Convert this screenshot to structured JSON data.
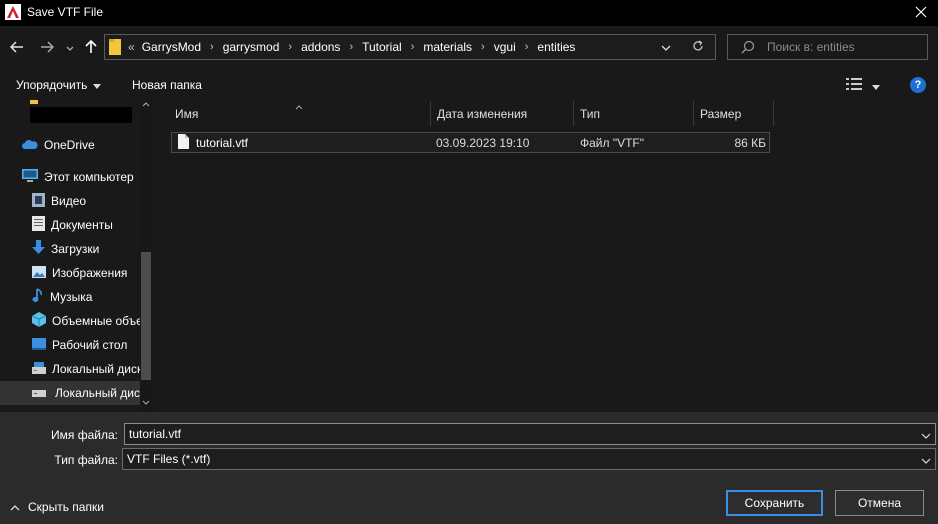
{
  "window": {
    "title": "Save VTF File"
  },
  "nav": {
    "breadcrumb_prefix": "«",
    "breadcrumbs": [
      "GarrysMod",
      "garrysmod",
      "addons",
      "Tutorial",
      "materials",
      "vgui",
      "entities"
    ],
    "search_placeholder": "Поиск в: entities"
  },
  "toolbar": {
    "organize_label": "Упорядочить",
    "new_folder_label": "Новая папка"
  },
  "sidebar": {
    "items": [
      {
        "label": "OneDrive",
        "icon": "cloud-icon"
      },
      {
        "label": "Этот компьютер",
        "icon": "computer-icon"
      },
      {
        "label": "Видео",
        "icon": "video-icon"
      },
      {
        "label": "Документы",
        "icon": "documents-icon"
      },
      {
        "label": "Загрузки",
        "icon": "download-icon"
      },
      {
        "label": "Изображения",
        "icon": "pictures-icon"
      },
      {
        "label": "Музыка",
        "icon": "music-icon"
      },
      {
        "label": "Объемные объекты",
        "icon": "3d-objects-icon"
      },
      {
        "label": "Рабочий стол",
        "icon": "desktop-icon"
      },
      {
        "label": "Локальный диск (C:)",
        "icon": "drive-icon"
      },
      {
        "label": "Локальный диск (D:)",
        "icon": "drive-icon"
      }
    ]
  },
  "columns": [
    "Имя",
    "Дата изменения",
    "Тип",
    "Размер"
  ],
  "files": [
    {
      "name": "tutorial.vtf",
      "modified": "03.09.2023 19:10",
      "type": "Файл \"VTF\"",
      "size": "86 КБ"
    }
  ],
  "form": {
    "filename_label": "Имя файла:",
    "filename_value": "tutorial.vtf",
    "filetype_label": "Тип файла:",
    "filetype_value": "VTF Files (*.vtf)"
  },
  "footer": {
    "hide_folders_label": "Скрыть папки",
    "save_label": "Сохранить",
    "cancel_label": "Отмена"
  },
  "colors": {
    "accent": "#3a8ee6",
    "folder": "#f3c440",
    "help": "#1f6fd6"
  }
}
